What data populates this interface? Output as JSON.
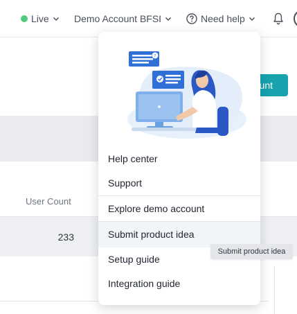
{
  "header": {
    "live_label": "Live",
    "account_label": "Demo Account BFSI",
    "help_label": "Need help",
    "colors": {
      "live_dot": "#4fc97c",
      "accent": "#17a2ad"
    }
  },
  "page": {
    "cta_label_partial": "unt",
    "table": {
      "column_user_count": "User Count",
      "rows": [
        {
          "user_count": "233"
        }
      ]
    }
  },
  "help_menu": {
    "items": [
      {
        "label": "Help center"
      },
      {
        "label": "Support"
      },
      {
        "label": "Explore demo account"
      },
      {
        "label": "Submit product idea"
      },
      {
        "label": "Setup guide"
      },
      {
        "label": "Integration guide"
      }
    ],
    "hovered_index": 3
  },
  "tooltip": {
    "text": "Submit product idea"
  }
}
